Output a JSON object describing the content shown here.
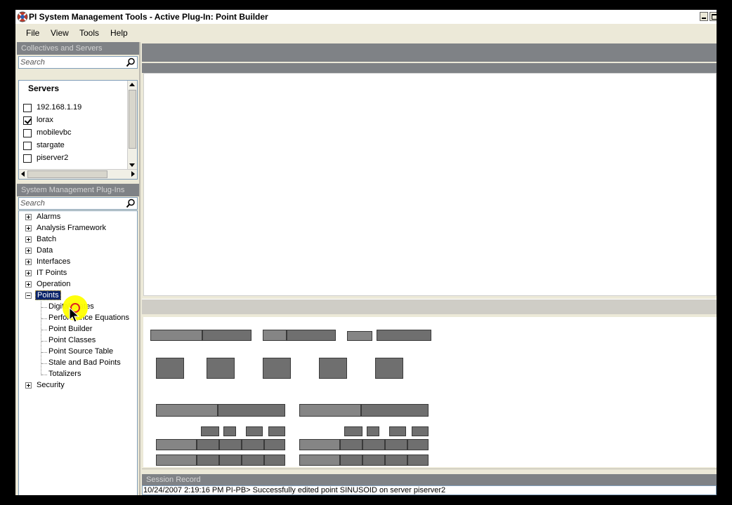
{
  "titlebar": {
    "title": "PI System Management Tools - Active Plug-In: Point Builder"
  },
  "menu": {
    "items": [
      "File",
      "View",
      "Tools",
      "Help"
    ]
  },
  "collectives": {
    "header": "Collectives and Servers",
    "search_placeholder": "Search",
    "column_header": "Servers",
    "servers": [
      {
        "name": "192.168.1.19",
        "checked": false
      },
      {
        "name": "lorax",
        "checked": true
      },
      {
        "name": "mobilevbc",
        "checked": false
      },
      {
        "name": "stargate",
        "checked": false
      },
      {
        "name": "piserver2",
        "checked": false
      }
    ]
  },
  "plugins": {
    "header": "System Management Plug-Ins",
    "search_placeholder": "Search",
    "tree": [
      {
        "label": "Alarms",
        "expanded": false
      },
      {
        "label": "Analysis Framework",
        "expanded": false
      },
      {
        "label": "Batch",
        "expanded": false
      },
      {
        "label": "Data",
        "expanded": false
      },
      {
        "label": "Interfaces",
        "expanded": false
      },
      {
        "label": "IT Points",
        "expanded": false
      },
      {
        "label": "Operation",
        "expanded": false
      },
      {
        "label": "Points",
        "expanded": true,
        "selected": true,
        "children": [
          "Digital States",
          "Performance Equations",
          "Point Builder",
          "Point Classes",
          "Point Source Table",
          "Stale and Bad Points",
          "Totalizers"
        ]
      },
      {
        "label": "Security",
        "expanded": false
      }
    ]
  },
  "session": {
    "header": "Session Record",
    "log": "10/24/2007 2:19:16 PM PI-PB> Successfully edited point SINUSOID on server piserver2"
  },
  "colors": {
    "pane_header_bg": "#7f8286",
    "selected_bg": "#0a246a",
    "window_bg": "#ece9d8",
    "highlight": "#ffff00"
  }
}
